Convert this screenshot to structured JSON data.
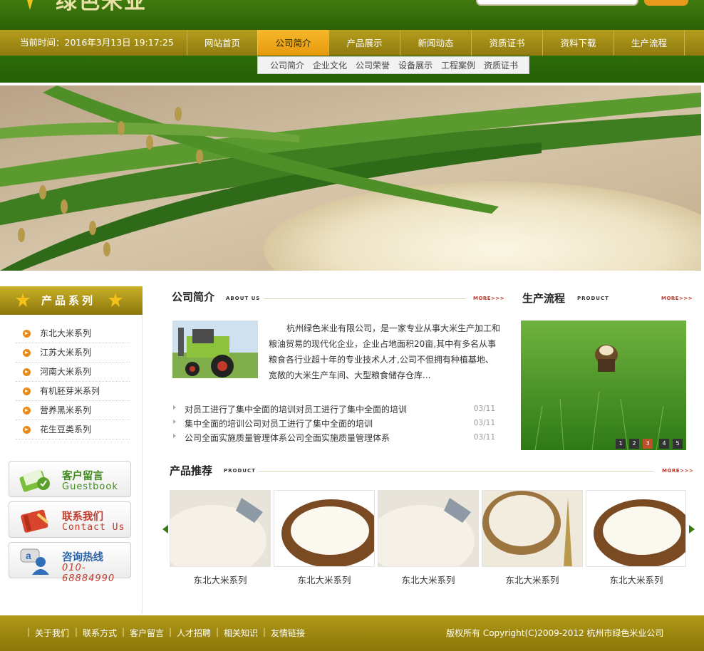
{
  "site": {
    "logo_text": "绿色米业",
    "current_time": "当前时间：2016年3月13日 19:17:25"
  },
  "nav": {
    "items": [
      "网站首页",
      "公司简介",
      "产品展示",
      "新闻动态",
      "资质证书",
      "资料下载",
      "生产流程"
    ],
    "active": "公司简介",
    "submenu": [
      "公司简介",
      "企业文化",
      "公司荣誉",
      "设备展示",
      "工程案例",
      "资质证书"
    ]
  },
  "sidebar": {
    "title": "产品系列",
    "categories": [
      "东北大米系列",
      "江苏大米系列",
      "河南大米系列",
      "有机胚芽米系列",
      "营养黑米系列",
      "花生豆类系列"
    ],
    "guestbook": {
      "title": "客户留言",
      "subtitle": "Guestbook"
    },
    "contact": {
      "title": "联系我们",
      "subtitle": "Contact Us"
    },
    "hotline": {
      "title": "咨询热线",
      "subtitle": "010-68884990"
    }
  },
  "about": {
    "title": "公司简介",
    "en": "ABOUT US",
    "more": "MORE>>>",
    "text": "杭州绿色米业有限公司，是一家专业从事大米生产加工和粮油贸易的现代化企业，企业占地面积20亩,其中有多名从事粮食各行业超十年的专业技术人才,公司不但拥有种植基地、宽敞的大米生产车间、大型粮食储存仓库..."
  },
  "news": [
    {
      "title": "对员工进行了集中全面的培训对员工进行了集中全面的培训",
      "date": "03/11"
    },
    {
      "title": "集中全面的培训公司对员工进行了集中全面的培训",
      "date": "03/11"
    },
    {
      "title": "公司全面实施质量管理体系公司全面实施质量管理体系",
      "date": "03/11"
    }
  ],
  "process": {
    "title": "生产流程",
    "en": "PRODUCT",
    "more": "MORE>>>",
    "pages": [
      "1",
      "2",
      "3",
      "4",
      "5"
    ],
    "active_page": "3"
  },
  "products": {
    "title": "产品推荐",
    "en": "PRODUCT",
    "more": "MORE>>>",
    "items": [
      "东北大米系列",
      "东北大米系列",
      "东北大米系列",
      "东北大米系列",
      "东北大米系列"
    ]
  },
  "footer": {
    "links": [
      "关于我们",
      "联系方式",
      "客户留言",
      "人才招聘",
      "相关知识",
      "友情链接"
    ],
    "copyright": "版权所有 Copyright(C)2009-2012 杭州市绿色米业公司"
  },
  "colors": {
    "green": "#2d6206",
    "gold": "#9f8912",
    "orange": "#e7980d",
    "more_red": "#c0392b"
  }
}
